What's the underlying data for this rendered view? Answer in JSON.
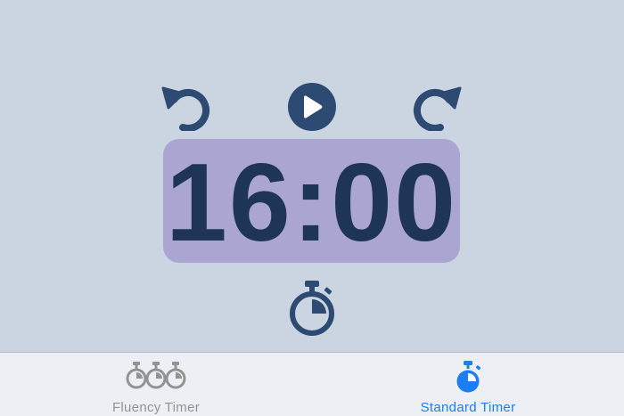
{
  "timer": {
    "display": "16:00"
  },
  "controls": {
    "reset_icon": "undo-arrow-icon",
    "play_icon": "play-icon",
    "redo_icon": "redo-arrow-icon",
    "stopwatch_icon": "stopwatch-icon"
  },
  "tabs": [
    {
      "label": "Fluency Timer",
      "icon": "triple-stopwatch-icon",
      "selected": false
    },
    {
      "label": "Standard Timer",
      "icon": "stopwatch-icon",
      "selected": true
    }
  ],
  "colors": {
    "background": "#cbd5e2",
    "icon": "#2c4a72",
    "display_bg": "#aba6d1",
    "display_text": "#1f3558",
    "tab_active": "#1b7ef3",
    "tab_inactive": "#939393"
  }
}
